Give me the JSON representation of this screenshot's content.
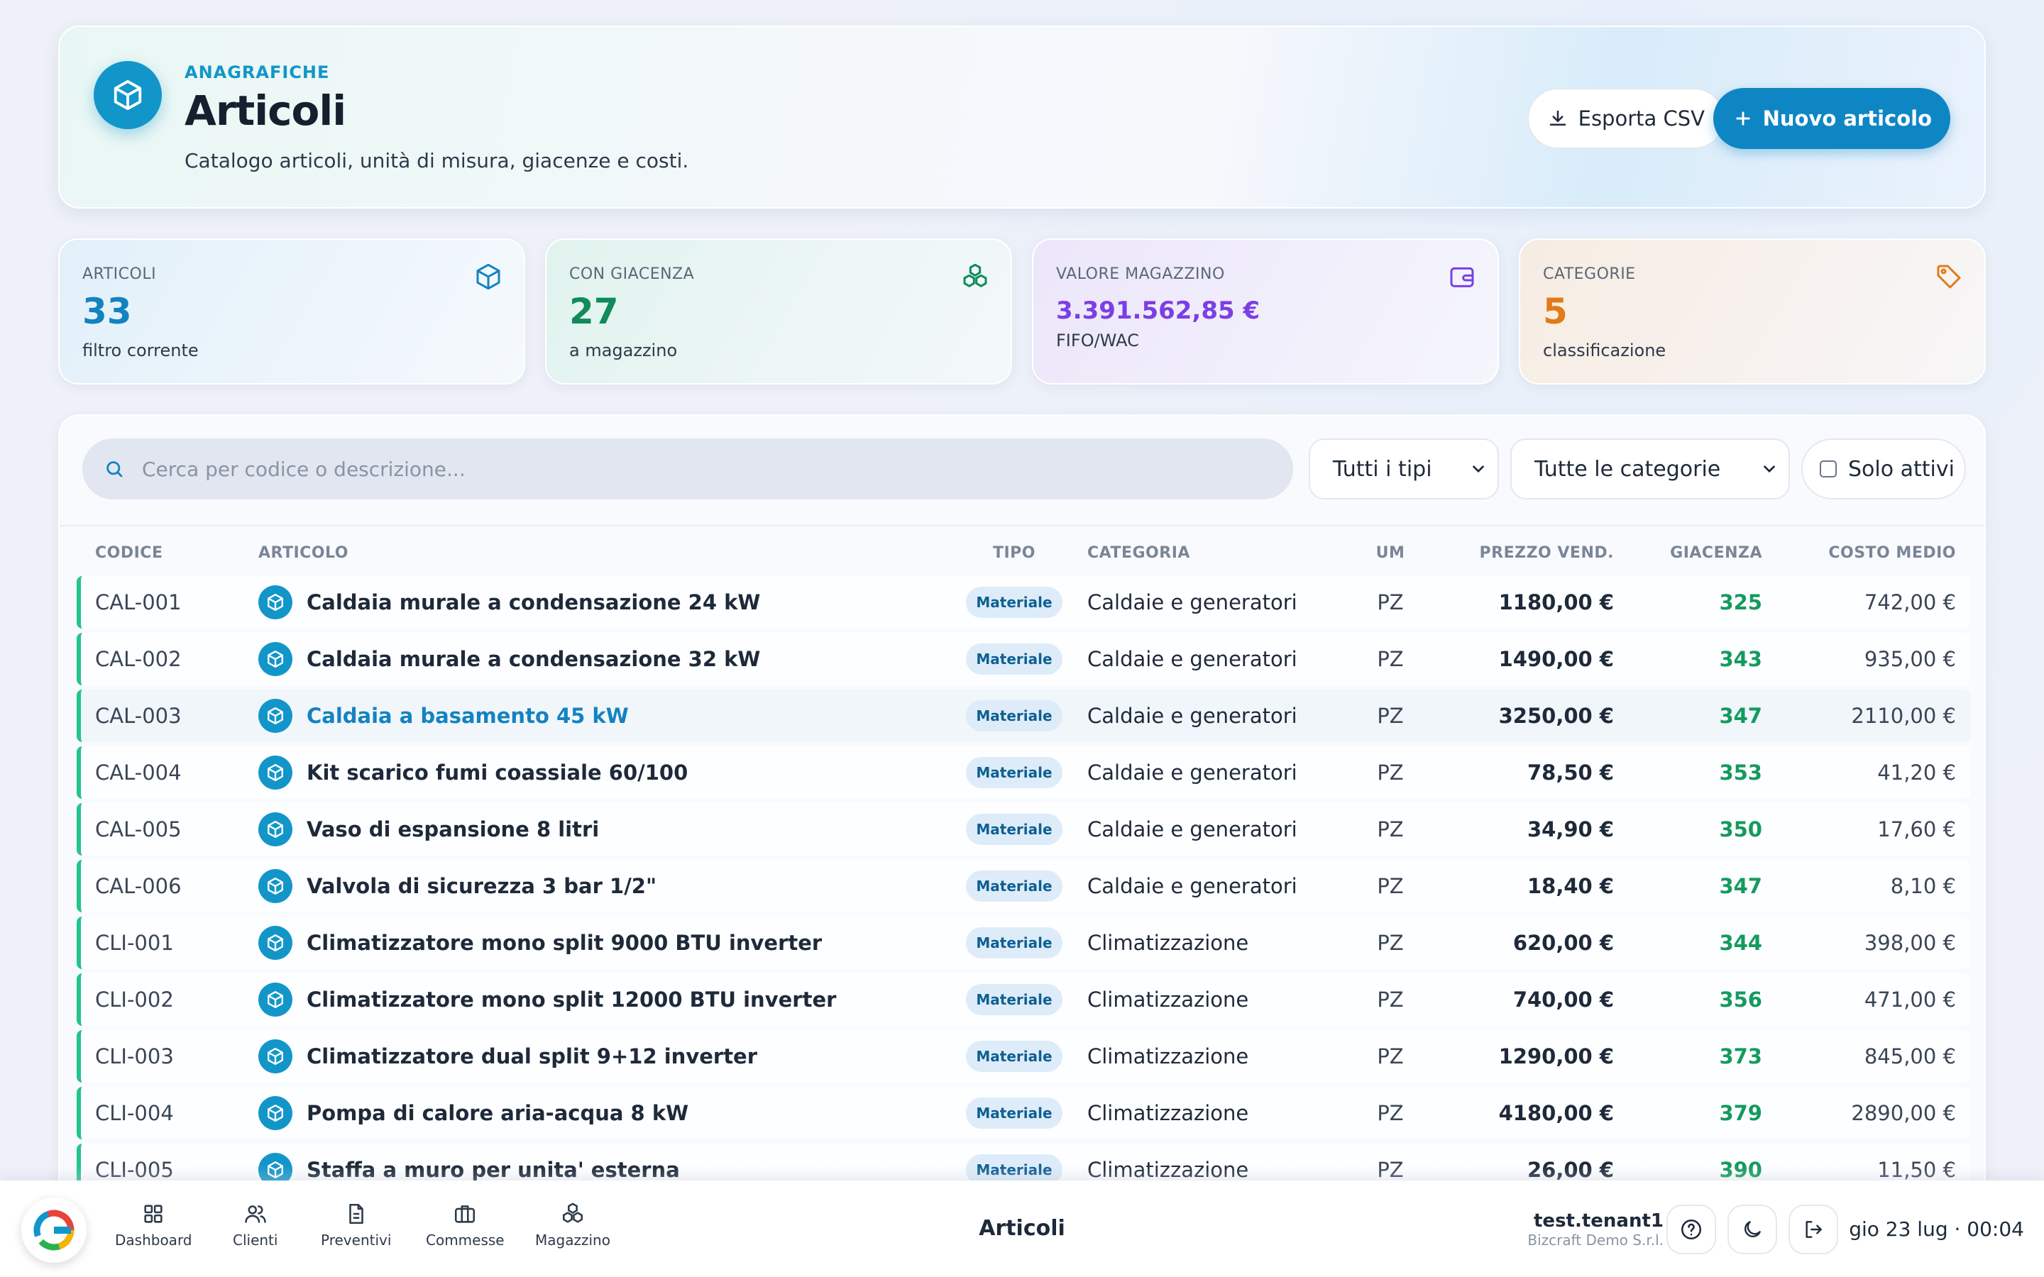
{
  "header": {
    "eyebrow": "ANAGRAFICHE",
    "title": "Articoli",
    "subtitle": "Catalogo articoli, unità di misura, giacenze e costi.",
    "export_label": "Esporta CSV",
    "new_label": "Nuovo articolo"
  },
  "stats": [
    {
      "label": "ARTICOLI",
      "value": "33",
      "sub": "filtro corrente"
    },
    {
      "label": "CON GIACENZA",
      "value": "27",
      "sub": "a magazzino"
    },
    {
      "label": "VALORE MAGAZZINO",
      "value": "3.391.562,85 €",
      "sub": "FIFO/WAC"
    },
    {
      "label": "CATEGORIE",
      "value": "5",
      "sub": "classificazione"
    }
  ],
  "filters": {
    "search_placeholder": "Cerca per codice o descrizione...",
    "type_select": "Tutti i tipi",
    "category_select": "Tutte le categorie",
    "active_only": "Solo attivi"
  },
  "table": {
    "columns": [
      "CODICE",
      "ARTICOLO",
      "TIPO",
      "CATEGORIA",
      "UM",
      "PREZZO VEND.",
      "GIACENZA",
      "COSTO MEDIO"
    ],
    "rows": [
      {
        "code": "CAL-001",
        "name": "Caldaia murale a condensazione 24 kW",
        "type": "Materiale",
        "category": "Caldaie e generatori",
        "um": "PZ",
        "price": "1180,00 €",
        "stock": "325",
        "cost": "742,00 €"
      },
      {
        "code": "CAL-002",
        "name": "Caldaia murale a condensazione 32 kW",
        "type": "Materiale",
        "category": "Caldaie e generatori",
        "um": "PZ",
        "price": "1490,00 €",
        "stock": "343",
        "cost": "935,00 €"
      },
      {
        "code": "CAL-003",
        "name": "Caldaia a basamento 45 kW",
        "type": "Materiale",
        "category": "Caldaie e generatori",
        "um": "PZ",
        "price": "3250,00 €",
        "stock": "347",
        "cost": "2110,00 €"
      },
      {
        "code": "CAL-004",
        "name": "Kit scarico fumi coassiale 60/100",
        "type": "Materiale",
        "category": "Caldaie e generatori",
        "um": "PZ",
        "price": "78,50 €",
        "stock": "353",
        "cost": "41,20 €"
      },
      {
        "code": "CAL-005",
        "name": "Vaso di espansione 8 litri",
        "type": "Materiale",
        "category": "Caldaie e generatori",
        "um": "PZ",
        "price": "34,90 €",
        "stock": "350",
        "cost": "17,60 €"
      },
      {
        "code": "CAL-006",
        "name": "Valvola di sicurezza 3 bar 1/2\"",
        "type": "Materiale",
        "category": "Caldaie e generatori",
        "um": "PZ",
        "price": "18,40 €",
        "stock": "347",
        "cost": "8,10 €"
      },
      {
        "code": "CLI-001",
        "name": "Climatizzatore mono split 9000 BTU inverter",
        "type": "Materiale",
        "category": "Climatizzazione",
        "um": "PZ",
        "price": "620,00 €",
        "stock": "344",
        "cost": "398,00 €"
      },
      {
        "code": "CLI-002",
        "name": "Climatizzatore mono split 12000 BTU inverter",
        "type": "Materiale",
        "category": "Climatizzazione",
        "um": "PZ",
        "price": "740,00 €",
        "stock": "356",
        "cost": "471,00 €"
      },
      {
        "code": "CLI-003",
        "name": "Climatizzatore dual split 9+12 inverter",
        "type": "Materiale",
        "category": "Climatizzazione",
        "um": "PZ",
        "price": "1290,00 €",
        "stock": "373",
        "cost": "845,00 €"
      },
      {
        "code": "CLI-004",
        "name": "Pompa di calore aria-acqua 8 kW",
        "type": "Materiale",
        "category": "Climatizzazione",
        "um": "PZ",
        "price": "4180,00 €",
        "stock": "379",
        "cost": "2890,00 €"
      },
      {
        "code": "CLI-005",
        "name": "Staffa a muro per unita' esterna",
        "type": "Materiale",
        "category": "Climatizzazione",
        "um": "PZ",
        "price": "26,00 €",
        "stock": "390",
        "cost": "11,50 €"
      }
    ]
  },
  "bottom_bar": {
    "nav": [
      "Dashboard",
      "Clienti",
      "Preventivi",
      "Commesse",
      "Magazzino"
    ],
    "page_title": "Articoli",
    "user_name": "test.tenant1",
    "tenant": "Bizcraft Demo S.r.l.",
    "datetime": "gio 23 lug · 00:04"
  },
  "colors": {
    "accent": "#1296c9",
    "primary_button": "#0f86c4",
    "stock": "#159a5e",
    "row_marker": "#22c58a"
  }
}
